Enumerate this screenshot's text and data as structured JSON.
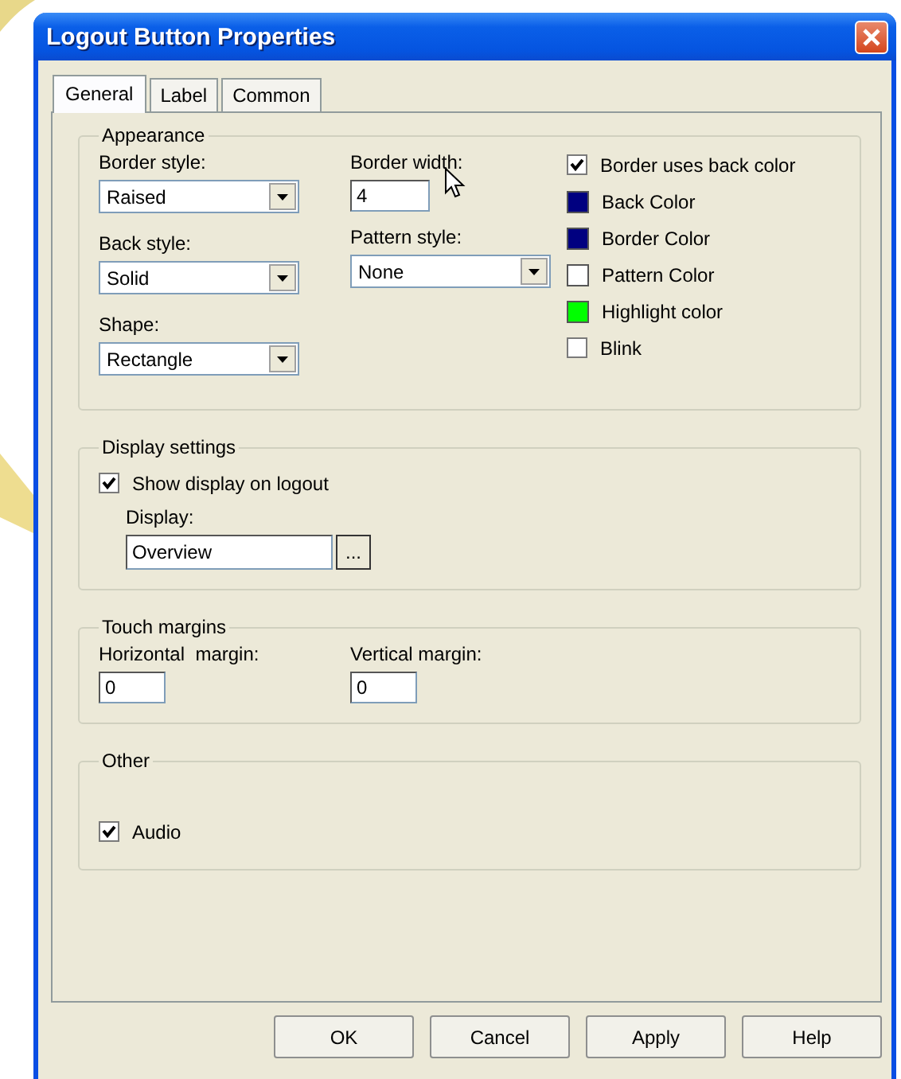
{
  "window": {
    "title": "Logout Button Properties"
  },
  "tabs": [
    {
      "label": "General",
      "selected": true
    },
    {
      "label": "Label",
      "selected": false
    },
    {
      "label": "Common",
      "selected": false
    }
  ],
  "appearance": {
    "title": "Appearance",
    "border_style": {
      "label": "Border style:",
      "value": "Raised"
    },
    "border_width": {
      "label": "Border width:",
      "value": "4"
    },
    "back_style": {
      "label": "Back style:",
      "value": "Solid"
    },
    "pattern_style": {
      "label": "Pattern style:",
      "value": "None"
    },
    "shape": {
      "label": "Shape:",
      "value": "Rectangle"
    },
    "options": [
      {
        "kind": "checkbox",
        "label": "Border uses back color",
        "checked": true
      },
      {
        "kind": "swatch",
        "label": "Back Color",
        "color": "#000080"
      },
      {
        "kind": "swatch",
        "label": "Border Color",
        "color": "#000080"
      },
      {
        "kind": "swatch",
        "label": "Pattern Color",
        "color": "#ffffff"
      },
      {
        "kind": "swatch",
        "label": "Highlight color",
        "color": "#00ff00"
      },
      {
        "kind": "checkbox",
        "label": "Blink",
        "checked": false
      }
    ]
  },
  "display_settings": {
    "title": "Display settings",
    "show_display": {
      "label": "Show display on logout",
      "checked": true
    },
    "display": {
      "label": "Display:",
      "value": "Overview",
      "browse": "..."
    }
  },
  "touch_margins": {
    "title": "Touch margins",
    "horizontal": {
      "label": "Horizontal  margin:",
      "value": "0"
    },
    "vertical": {
      "label": "Vertical margin:",
      "value": "0"
    }
  },
  "other": {
    "title": "Other",
    "audio": {
      "label": "Audio",
      "checked": true
    }
  },
  "buttons": [
    "OK",
    "Cancel",
    "Apply",
    "Help"
  ]
}
